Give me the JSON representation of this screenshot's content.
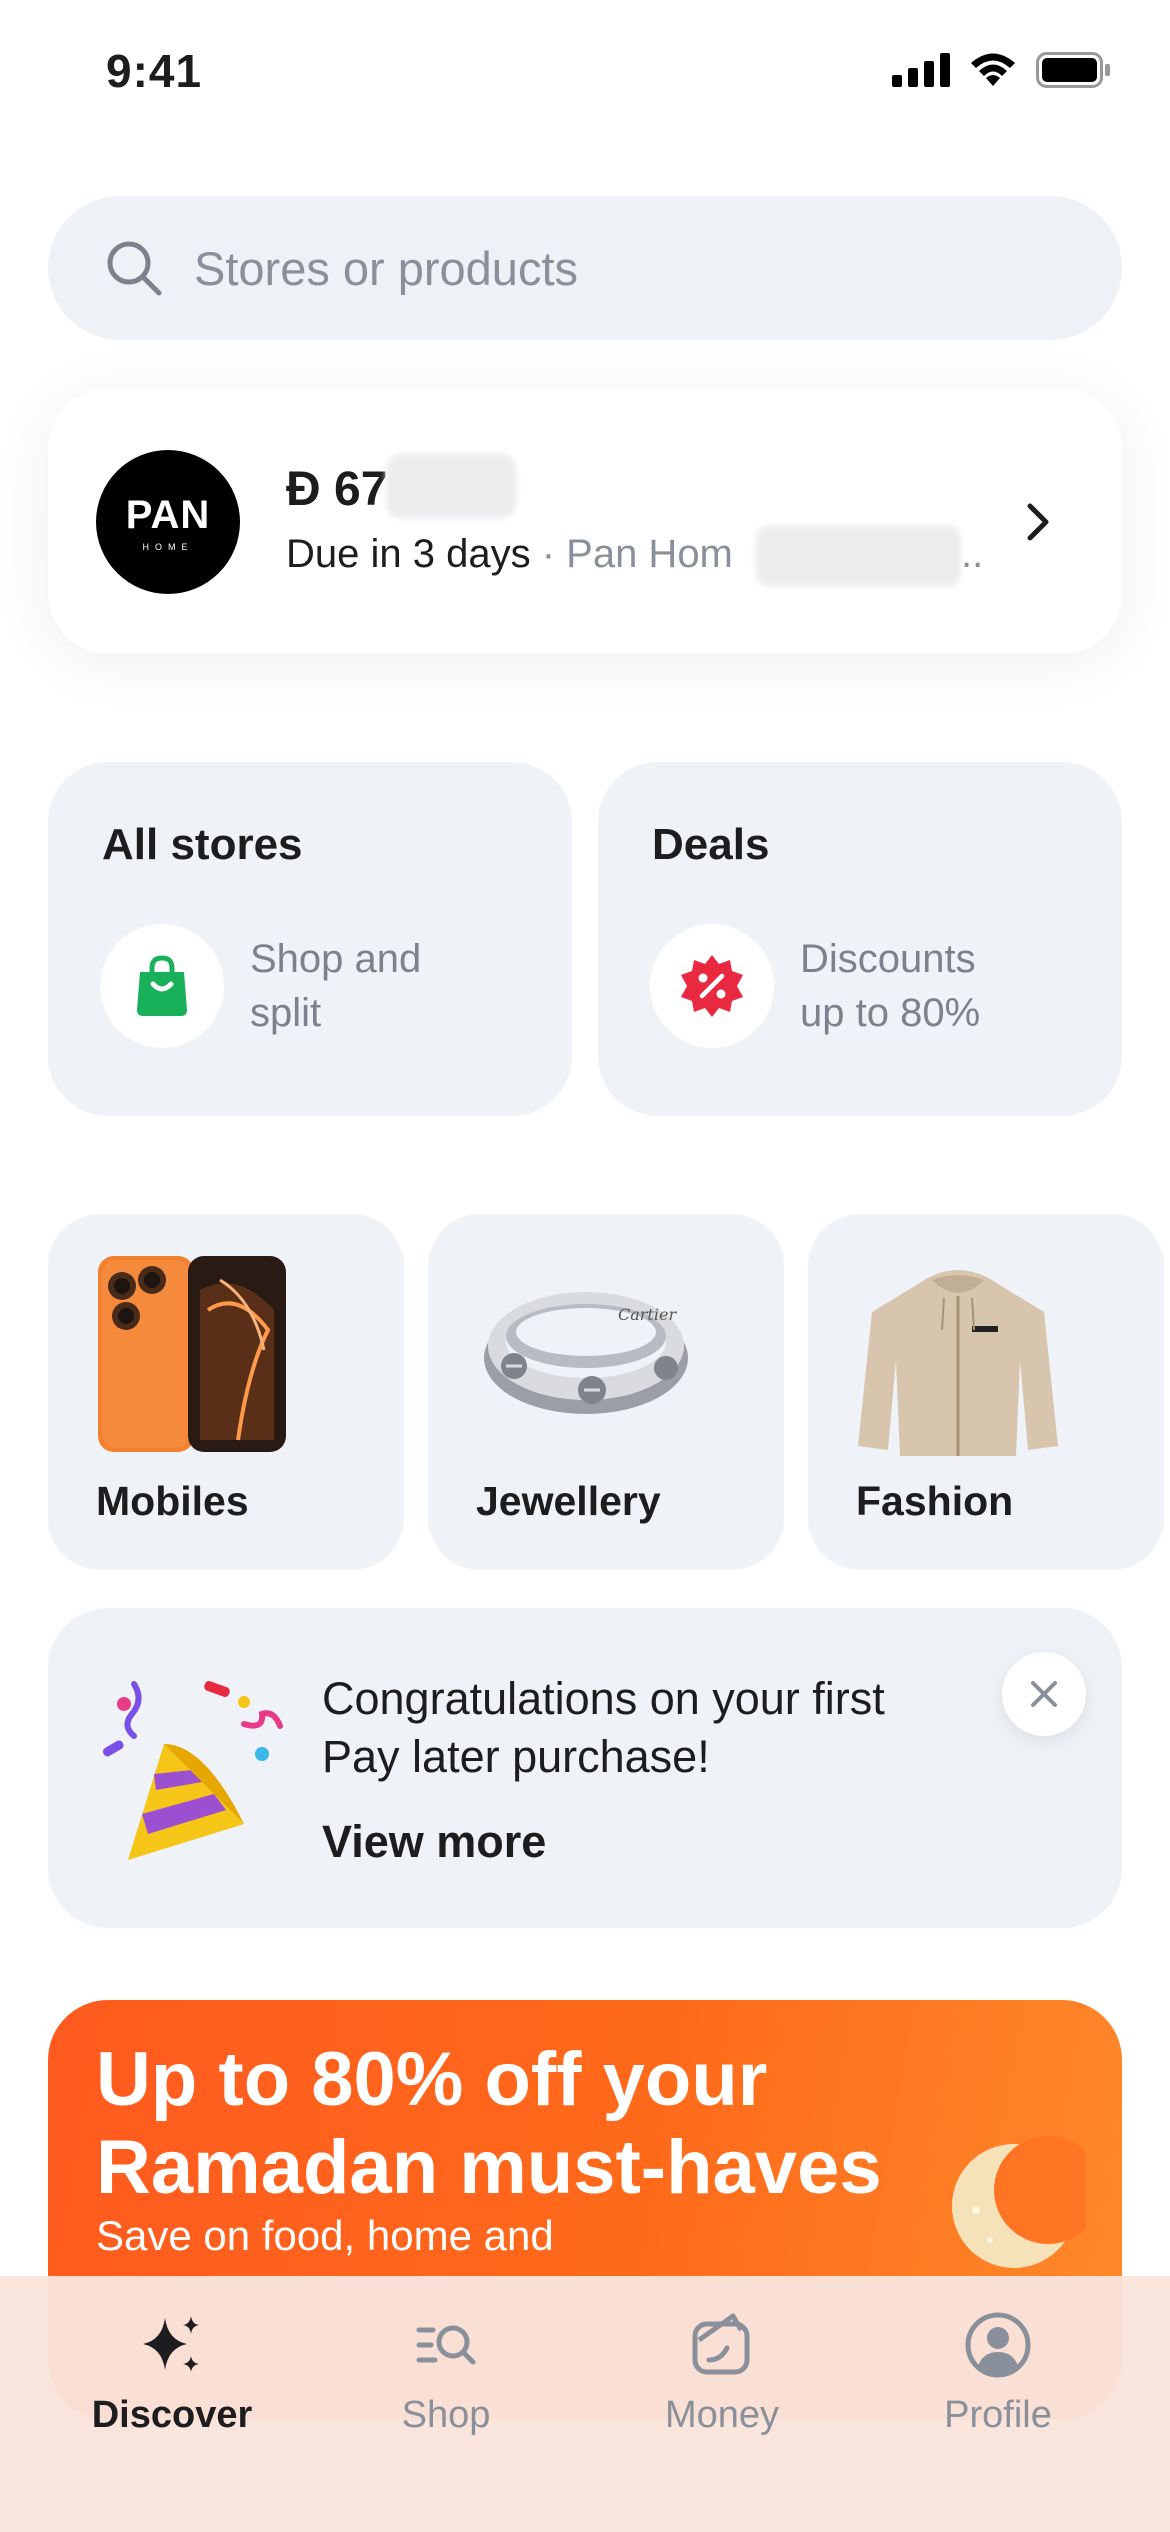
{
  "status_bar": {
    "time": "9:41"
  },
  "search": {
    "placeholder": "Stores or products"
  },
  "due_card": {
    "logo_text": "PAN",
    "logo_subtext": "HOME",
    "amount": "Đ 67",
    "due_text": "Due in 3 days",
    "separator": " · ",
    "merchant": "Pan Hom",
    "ellipsis": ".."
  },
  "tiles": [
    {
      "title": "All stores",
      "subtitle_line1": "Shop and",
      "subtitle_line2": "split",
      "icon": "shopping-bag-icon",
      "icon_color": "#19b05a"
    },
    {
      "title": "Deals",
      "subtitle_line1": "Discounts",
      "subtitle_line2": "up to 80%",
      "icon": "discount-badge-icon",
      "icon_color": "#e8293f"
    }
  ],
  "categories": [
    {
      "label": "Mobiles",
      "icon": "phone-image"
    },
    {
      "label": "Jewellery",
      "icon": "ring-image",
      "engraving": "Cartier"
    },
    {
      "label": "Fashion",
      "icon": "hoodie-image"
    }
  ],
  "congrats": {
    "title_line1": "Congratulations on your first",
    "title_line2": "Pay later purchase!",
    "link": "View more"
  },
  "promo": {
    "title_line1": "Up to 80% off your",
    "title_line2": "Ramadan must-haves",
    "subtitle": "Save on food, home and",
    "color": "#ff5a1f"
  },
  "tabbar": {
    "items": [
      {
        "label": "Discover",
        "icon": "sparkles-icon",
        "active": true
      },
      {
        "label": "Shop",
        "icon": "shop-search-icon",
        "active": false
      },
      {
        "label": "Money",
        "icon": "wallet-icon",
        "active": false
      },
      {
        "label": "Profile",
        "icon": "profile-icon",
        "active": false
      }
    ]
  },
  "colors": {
    "accent_green": "#19b05a",
    "accent_red": "#e8293f",
    "muted_text": "#8a909b",
    "card_bg": "#eff2f6"
  }
}
